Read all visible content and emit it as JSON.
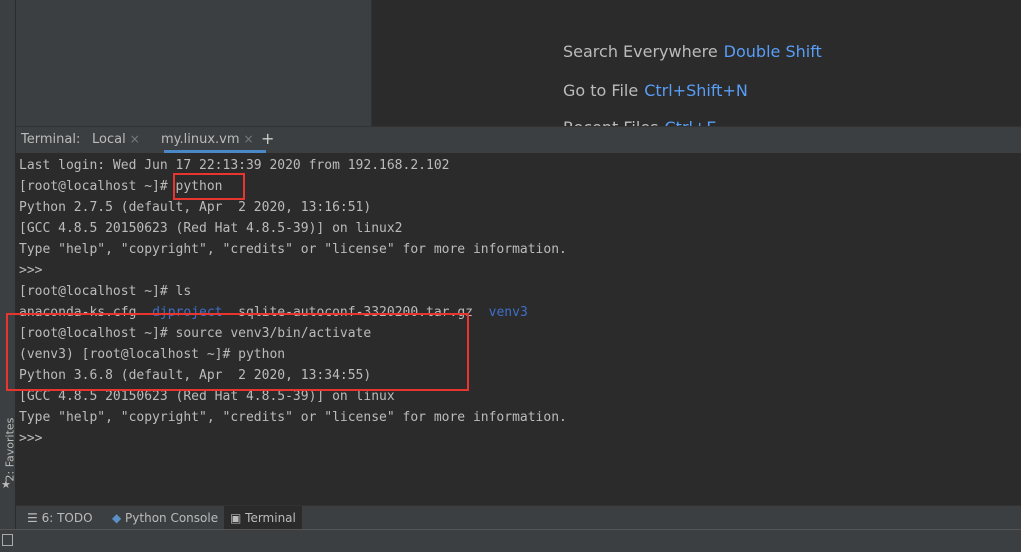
{
  "left_strip": {
    "favorites_label": "2: Favorites",
    "star": "★"
  },
  "editor_hints": [
    {
      "label": "Search Everywhere",
      "key": "Double Shift"
    },
    {
      "label": "Go to File",
      "key": "Ctrl+Shift+N"
    },
    {
      "label": "Recent Files",
      "key": "Ctrl+E"
    }
  ],
  "terminal_tabs": {
    "title": "Terminal:",
    "tabs": [
      {
        "label": "Local",
        "close": "×"
      },
      {
        "label": "my.linux.vm",
        "close": "×"
      }
    ],
    "new_tab": "+"
  },
  "terminal": {
    "lines": [
      "Last login: Wed Jun 17 22:13:39 2020 from 192.168.2.102",
      "[root@localhost ~]# python",
      "Python 2.7.5 (default, Apr  2 2020, 13:16:51)",
      "[GCC 4.8.5 20150623 (Red Hat 4.8.5-39)] on linux2",
      "Type \"help\", \"copyright\", \"credits\" or \"license\" for more information.",
      ">>>",
      "[root@localhost ~]# ls",
      "",
      "[root@localhost ~]# source venv3/bin/activate",
      "(venv3) [root@localhost ~]# python",
      "Python 3.6.8 (default, Apr  2 2020, 13:34:55)",
      "[GCC 4.8.5 20150623 (Red Hat 4.8.5-39)] on linux",
      "Type \"help\", \"copyright\", \"credits\" or \"license\" for more information.",
      ">>>"
    ],
    "ls_output": {
      "file1": "anaconda-ks.cfg",
      "dir1": "djproject",
      "file2": "sqlite-autoconf-3320200.tar.gz",
      "dir2": "venv3"
    }
  },
  "bottom_tabs": [
    {
      "label": "6: TODO",
      "icon": "list-icon"
    },
    {
      "label": "Python Console",
      "icon": "python-icon"
    },
    {
      "label": "Terminal",
      "icon": "terminal-icon"
    }
  ],
  "colors": {
    "annotation": "#e8352f",
    "key_hint": "#589df6",
    "directory": "#3f6fc8"
  }
}
